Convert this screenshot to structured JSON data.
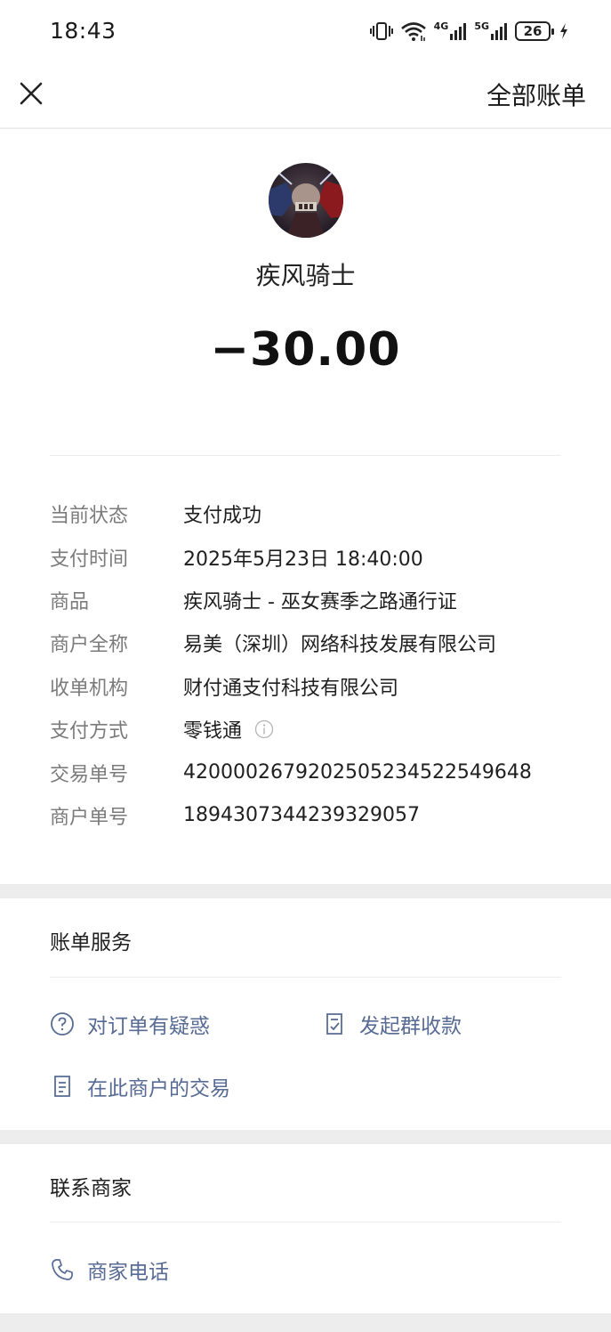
{
  "status_bar": {
    "time": "18:43",
    "network_1": "4G",
    "network_2": "5G",
    "battery": "26",
    "icons": [
      "vibrate-icon",
      "wifi-icon",
      "signal-4g-icon",
      "signal-5g-icon",
      "battery-icon",
      "charging-icon"
    ]
  },
  "nav": {
    "close_icon": "close-icon",
    "all_bills_label": "全部账单"
  },
  "transaction": {
    "merchant_name": "疾风骑士",
    "amount": "−30.00"
  },
  "details": [
    {
      "label": "当前状态",
      "value": "支付成功"
    },
    {
      "label": "支付时间",
      "value": "2025年5月23日 18:40:00"
    },
    {
      "label": "商品",
      "value": "疾风骑士 - 巫女赛季之路通行证"
    },
    {
      "label": "商户全称",
      "value": "易美（深圳）网络科技发展有限公司"
    },
    {
      "label": "收单机构",
      "value": "财付通支付科技有限公司"
    },
    {
      "label": "支付方式",
      "value": "零钱通"
    },
    {
      "label": "交易单号",
      "value": "4200002679202505234522549648"
    },
    {
      "label": "商户单号",
      "value": "1894307344239329057"
    }
  ],
  "bill_service": {
    "title": "账单服务",
    "question_order": "对订单有疑惑",
    "group_collect": "发起群收款",
    "merchant_transactions": "在此商户的交易"
  },
  "contact": {
    "title": "联系商家",
    "merchant_phone": "商家电话"
  },
  "colors": {
    "link": "#576b95",
    "label_gray": "#7b7b7b",
    "page_bg": "#ededed"
  }
}
